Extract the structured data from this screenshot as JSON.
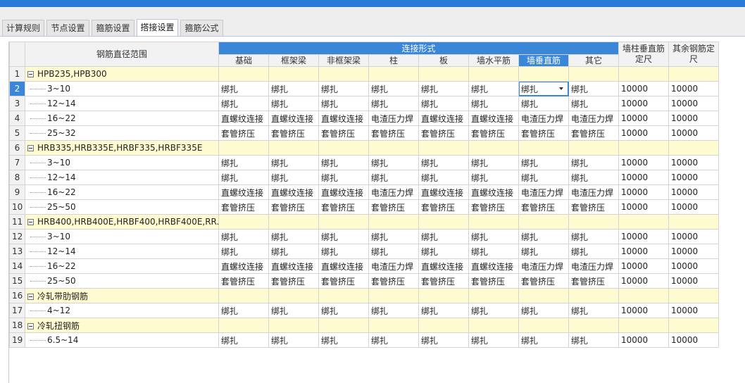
{
  "tabs": [
    {
      "label": "计算规则",
      "active": false
    },
    {
      "label": "节点设置",
      "active": false
    },
    {
      "label": "箍筋设置",
      "active": false
    },
    {
      "label": "搭接设置",
      "active": true
    },
    {
      "label": "箍筋公式",
      "active": false
    }
  ],
  "header": {
    "range": "钢筋直径范围",
    "group": "连接形式",
    "types": [
      "基础",
      "框架梁",
      "非框架梁",
      "柱",
      "板",
      "墙水平筋",
      "墙垂直筋",
      "其它"
    ],
    "wall_len": "墙柱垂直筋定尺",
    "other_len": "其余钢筋定尺"
  },
  "rows": [
    {
      "n": "1",
      "group": true,
      "name": "HPB235,HPB300"
    },
    {
      "n": "2",
      "name": "3~10",
      "c": [
        "绑扎",
        "绑扎",
        "绑扎",
        "绑扎",
        "绑扎",
        "绑扎",
        "绑扎",
        "绑扎"
      ],
      "a": "10000",
      "b": "10000"
    },
    {
      "n": "3",
      "name": "12~14",
      "c": [
        "绑扎",
        "绑扎",
        "绑扎",
        "绑扎",
        "绑扎",
        "绑扎",
        "绑扎",
        "绑扎"
      ],
      "a": "10000",
      "b": "10000"
    },
    {
      "n": "4",
      "name": "16~22",
      "c": [
        "直螺纹连接",
        "直螺纹连接",
        "直螺纹连接",
        "电渣压力焊",
        "直螺纹连接",
        "直螺纹连接",
        "电渣压力焊",
        "电渣压力焊"
      ],
      "a": "10000",
      "b": "10000"
    },
    {
      "n": "5",
      "name": "25~32",
      "c": [
        "套管挤压",
        "套管挤压",
        "套管挤压",
        "套管挤压",
        "套管挤压",
        "套管挤压",
        "套管挤压",
        "套管挤压"
      ],
      "a": "10000",
      "b": "10000"
    },
    {
      "n": "6",
      "group": true,
      "name": "HRB335,HRB335E,HRBF335,HRBF335E"
    },
    {
      "n": "7",
      "name": "3~10",
      "c": [
        "绑扎",
        "绑扎",
        "绑扎",
        "绑扎",
        "绑扎",
        "绑扎",
        "绑扎",
        "绑扎"
      ],
      "a": "10000",
      "b": "10000"
    },
    {
      "n": "8",
      "name": "12~14",
      "c": [
        "绑扎",
        "绑扎",
        "绑扎",
        "绑扎",
        "绑扎",
        "绑扎",
        "绑扎",
        "绑扎"
      ],
      "a": "10000",
      "b": "10000"
    },
    {
      "n": "9",
      "name": "16~22",
      "c": [
        "直螺纹连接",
        "直螺纹连接",
        "直螺纹连接",
        "电渣压力焊",
        "直螺纹连接",
        "直螺纹连接",
        "电渣压力焊",
        "电渣压力焊"
      ],
      "a": "10000",
      "b": "10000"
    },
    {
      "n": "10",
      "name": "25~50",
      "c": [
        "套管挤压",
        "套管挤压",
        "套管挤压",
        "套管挤压",
        "套管挤压",
        "套管挤压",
        "套管挤压",
        "套管挤压"
      ],
      "a": "10000",
      "b": "10000"
    },
    {
      "n": "11",
      "group": true,
      "name": "HRB400,HRB400E,HRBF400,HRBF400E,RR..."
    },
    {
      "n": "12",
      "name": "3~10",
      "c": [
        "绑扎",
        "绑扎",
        "绑扎",
        "绑扎",
        "绑扎",
        "绑扎",
        "绑扎",
        "绑扎"
      ],
      "a": "10000",
      "b": "10000"
    },
    {
      "n": "13",
      "name": "12~14",
      "c": [
        "绑扎",
        "绑扎",
        "绑扎",
        "绑扎",
        "绑扎",
        "绑扎",
        "绑扎",
        "绑扎"
      ],
      "a": "10000",
      "b": "10000"
    },
    {
      "n": "14",
      "name": "16~22",
      "c": [
        "直螺纹连接",
        "直螺纹连接",
        "直螺纹连接",
        "电渣压力焊",
        "直螺纹连接",
        "直螺纹连接",
        "电渣压力焊",
        "电渣压力焊"
      ],
      "a": "10000",
      "b": "10000"
    },
    {
      "n": "15",
      "name": "25~50",
      "c": [
        "套管挤压",
        "套管挤压",
        "套管挤压",
        "套管挤压",
        "套管挤压",
        "套管挤压",
        "套管挤压",
        "套管挤压"
      ],
      "a": "10000",
      "b": "10000"
    },
    {
      "n": "16",
      "group": true,
      "name": "冷轧带肋钢筋"
    },
    {
      "n": "17",
      "name": "4~12",
      "c": [
        "绑扎",
        "绑扎",
        "绑扎",
        "绑扎",
        "绑扎",
        "绑扎",
        "绑扎",
        "绑扎"
      ],
      "a": "10000",
      "b": "10000"
    },
    {
      "n": "18",
      "group": true,
      "name": "冷轧扭钢筋"
    },
    {
      "n": "19",
      "name": "6.5~14",
      "c": [
        "绑扎",
        "绑扎",
        "绑扎",
        "绑扎",
        "绑扎",
        "绑扎",
        "绑扎",
        "绑扎"
      ],
      "a": "10000",
      "b": "10000"
    }
  ],
  "selected": {
    "row": "2",
    "col": 6
  },
  "colors": {
    "accent": "#3a86d8",
    "group_bg": "#fffbd1",
    "header_bg": "#f2f2f2"
  }
}
